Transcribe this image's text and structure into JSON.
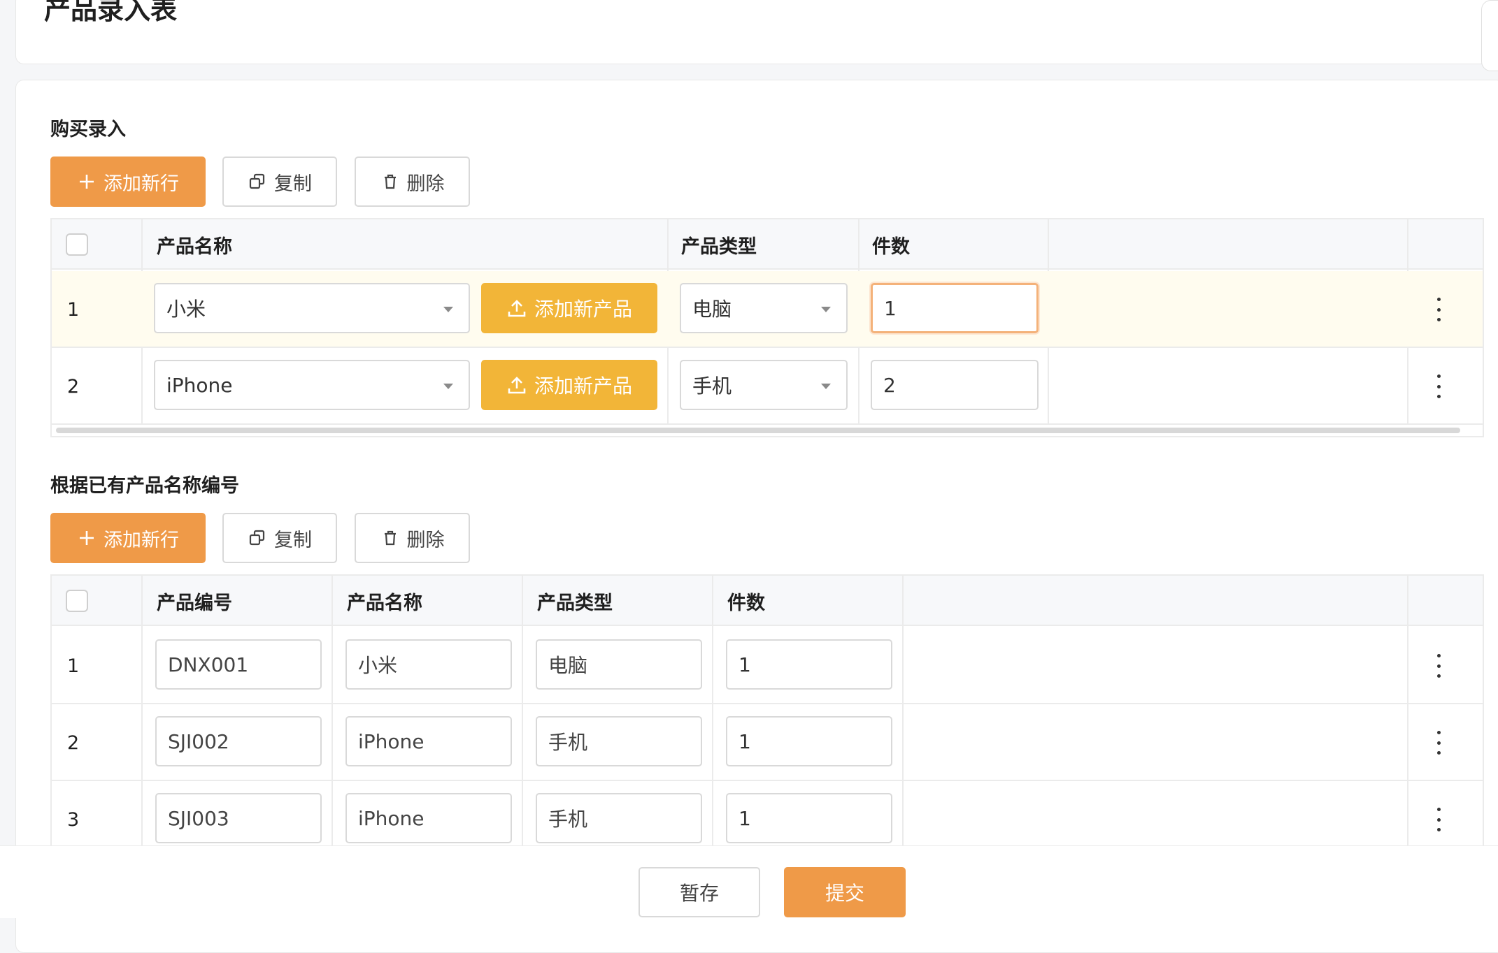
{
  "header": {
    "title": "产品录入表"
  },
  "purchase": {
    "title": "购买录入",
    "toolbar": {
      "add_label": "添加新行",
      "copy_label": "复制",
      "delete_label": "删除"
    },
    "columns": [
      "产品名称",
      "产品类型",
      "件数"
    ],
    "upload_label": "添加新产品",
    "rows": [
      {
        "index": "1",
        "name": "小米",
        "type": "电脑",
        "count": "1"
      },
      {
        "index": "2",
        "name": "iPhone",
        "type": "手机",
        "count": "2"
      }
    ]
  },
  "existing": {
    "title": "根据已有产品名称编号",
    "toolbar": {
      "add_label": "添加新行",
      "copy_label": "复制",
      "delete_label": "删除"
    },
    "columns": [
      "产品编号",
      "产品名称",
      "产品类型",
      "件数"
    ],
    "rows": [
      {
        "index": "1",
        "code": "DNX001",
        "name": "小米",
        "type": "电脑",
        "count": "1"
      },
      {
        "index": "2",
        "code": "SJI002",
        "name": "iPhone",
        "type": "手机",
        "count": "1"
      },
      {
        "index": "3",
        "code": "SJI003",
        "name": "iPhone",
        "type": "手机",
        "count": "1"
      }
    ]
  },
  "footer": {
    "save_label": "暂存",
    "submit_label": "提交"
  },
  "colors": {
    "primary": "#ef9a48",
    "upload": "#f2b538",
    "active_row": "#fffcef"
  }
}
